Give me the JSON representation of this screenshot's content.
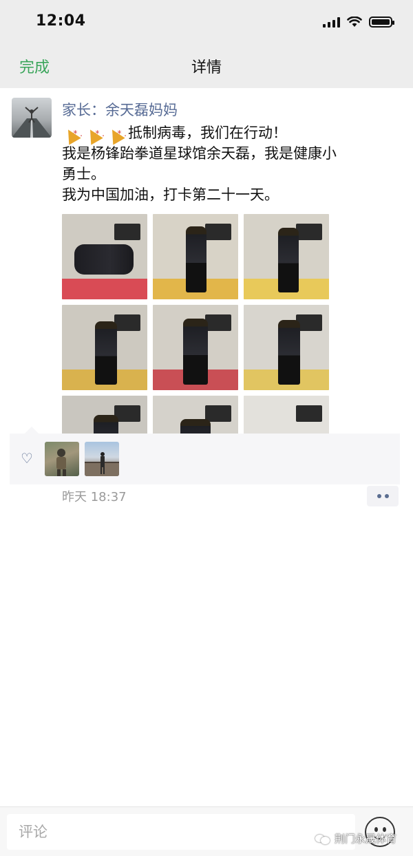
{
  "status_bar": {
    "time": "12:04"
  },
  "nav": {
    "done_label": "完成",
    "title": "详情"
  },
  "post": {
    "author": "家长：余天磊妈妈",
    "lines": [
      "抵制病毒，我们在行动！",
      "我是杨锋跆拳道星球馆余天磊，我是健康小",
      "勇士。",
      "我为中国加油，打卡第二十一天。"
    ],
    "emoji": [
      "party-popper-icon",
      "party-popper-icon",
      "party-popper-icon"
    ],
    "photo_count": 9,
    "time": "昨天 18:37"
  },
  "likes": {
    "icon": "heart-icon",
    "count": 2
  },
  "comment": {
    "placeholder": "评论"
  },
  "watermark": {
    "text": "荆门永晟体育"
  },
  "colors": {
    "accent_green": "#3aa55a",
    "link_blue": "#576b95",
    "nav_bg": "#ededed"
  }
}
